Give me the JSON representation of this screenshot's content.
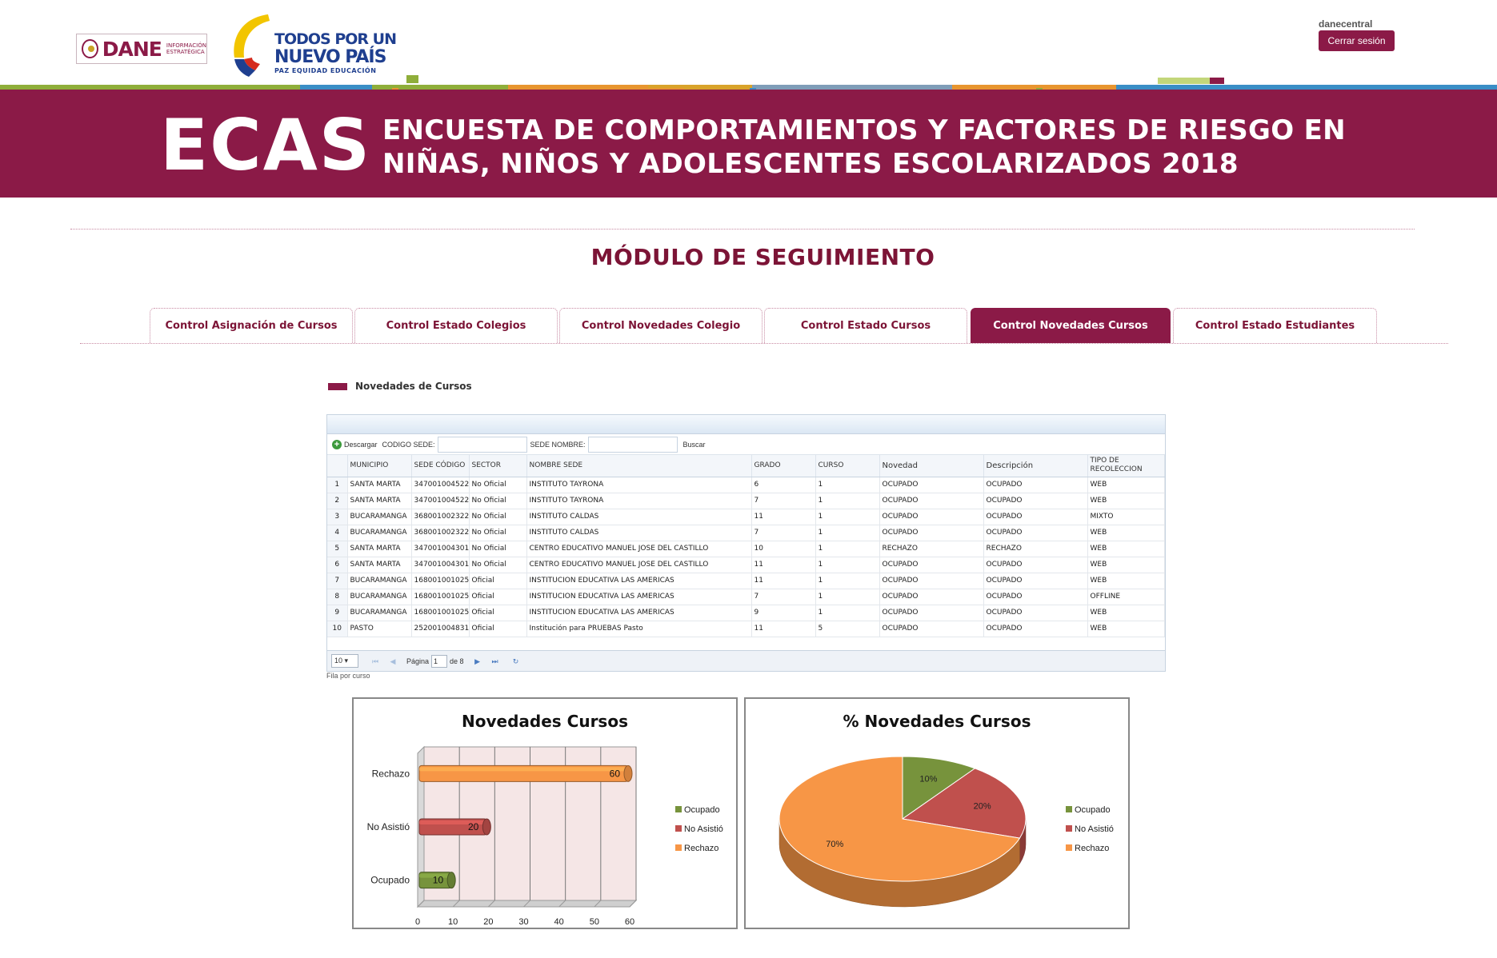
{
  "header": {
    "dane_logo_text": "DANE",
    "dane_logo_sub1": "INFORMACIÓN",
    "dane_logo_sub2": "ESTRATÉGICA",
    "gov_logo_line1": "TODOS POR UN",
    "gov_logo_line2": "NUEVO PAÍS",
    "gov_logo_line3": "PAZ  EQUIDAD  EDUCACIÓN",
    "username": "danecentral",
    "logout_label": "Cerrar sesión"
  },
  "banner": {
    "acronym": "ECAS",
    "title_line1": "ENCUESTA DE COMPORTAMIENTOS Y FACTORES DE RIESGO EN",
    "title_line2": "NIÑAS, NIÑOS Y ADOLESCENTES ESCOLARIZADOS 2018"
  },
  "page_title": "MÓDULO DE SEGUIMIENTO",
  "tabs": [
    {
      "label": "Control Asignación de Cursos",
      "active": false
    },
    {
      "label": "Control Estado Colegios",
      "active": false
    },
    {
      "label": "Control Novedades Colegio",
      "active": false
    },
    {
      "label": "Control Estado Cursos",
      "active": false
    },
    {
      "label": "Control Novedades Cursos",
      "active": true
    },
    {
      "label": "Control Estado Estudiantes",
      "active": false
    }
  ],
  "section_label": "Novedades de Cursos",
  "toolbar": {
    "download_label": "Descargar",
    "codigo_label": "CODIGO SEDE:",
    "codigo_value": "",
    "nombre_label": "SEDE NOMBRE:",
    "nombre_value": "",
    "search_label": "Buscar"
  },
  "table": {
    "columns": [
      "MUNICIPIO",
      "SEDE CÓDIGO",
      "SECTOR",
      "NOMBRE SEDE",
      "GRADO",
      "CURSO",
      "Novedad",
      "Descripción",
      "TIPO DE RECOLECCION"
    ],
    "rows": [
      [
        "1",
        "SANTA MARTA",
        "347001004522",
        "No Oficial",
        "INSTITUTO TAYRONA",
        "6",
        "1",
        "OCUPADO",
        "OCUPADO",
        "WEB"
      ],
      [
        "2",
        "SANTA MARTA",
        "347001004522",
        "No Oficial",
        "INSTITUTO TAYRONA",
        "7",
        "1",
        "OCUPADO",
        "OCUPADO",
        "WEB"
      ],
      [
        "3",
        "BUCARAMANGA",
        "368001002322",
        "No Oficial",
        "INSTITUTO CALDAS",
        "11",
        "1",
        "OCUPADO",
        "OCUPADO",
        "MIXTO"
      ],
      [
        "4",
        "BUCARAMANGA",
        "368001002322",
        "No Oficial",
        "INSTITUTO CALDAS",
        "7",
        "1",
        "OCUPADO",
        "OCUPADO",
        "WEB"
      ],
      [
        "5",
        "SANTA MARTA",
        "347001004301",
        "No Oficial",
        "CENTRO EDUCATIVO MANUEL JOSE DEL CASTILLO",
        "10",
        "1",
        "RECHAZO",
        "RECHAZO",
        "WEB"
      ],
      [
        "6",
        "SANTA MARTA",
        "347001004301",
        "No Oficial",
        "CENTRO EDUCATIVO MANUEL JOSE DEL CASTILLO",
        "11",
        "1",
        "OCUPADO",
        "OCUPADO",
        "WEB"
      ],
      [
        "7",
        "BUCARAMANGA",
        "168001001025",
        "Oficial",
        "INSTITUCION EDUCATIVA LAS AMERICAS",
        "11",
        "1",
        "OCUPADO",
        "OCUPADO",
        "WEB"
      ],
      [
        "8",
        "BUCARAMANGA",
        "168001001025",
        "Oficial",
        "INSTITUCION EDUCATIVA LAS AMERICAS",
        "7",
        "1",
        "OCUPADO",
        "OCUPADO",
        "OFFLINE"
      ],
      [
        "9",
        "BUCARAMANGA",
        "168001001025",
        "Oficial",
        "INSTITUCION EDUCATIVA LAS AMERICAS",
        "9",
        "1",
        "OCUPADO",
        "OCUPADO",
        "WEB"
      ],
      [
        "10",
        "PASTO",
        "252001004831",
        "Oficial",
        "Institución para PRUEBAS Pasto",
        "11",
        "5",
        "OCUPADO",
        "OCUPADO",
        "WEB"
      ]
    ]
  },
  "pager": {
    "rows_per_page": "10",
    "page_label": "Página",
    "current_page": "1",
    "of_label": "de 8",
    "caption": "Fila por curso"
  },
  "colors": {
    "brand": "#8b1a47",
    "ocupado": "#77933c",
    "no_asistio": "#c0504d",
    "rechazo": "#f79646"
  },
  "chart_data": [
    {
      "type": "bar",
      "orientation": "horizontal",
      "title": "Novedades Cursos",
      "categories": [
        "Ocupado",
        "No Asistió",
        "Rechazo"
      ],
      "values": [
        10,
        20,
        60
      ],
      "data_labels": [
        "10",
        "20",
        "60"
      ],
      "xlim": [
        0,
        60
      ],
      "x_ticks": [
        "0",
        "10",
        "20",
        "30",
        "40",
        "50",
        "60"
      ],
      "legend": [
        "Ocupado",
        "No Asistió",
        "Rechazo"
      ],
      "legend_position": "right",
      "grid": true
    },
    {
      "type": "pie",
      "title": "% Novedades Cursos",
      "categories": [
        "Ocupado",
        "No Asistió",
        "Rechazo"
      ],
      "values": [
        10,
        20,
        70
      ],
      "data_labels": [
        "10%",
        "20%",
        "70%"
      ],
      "legend": [
        "Ocupado",
        "No Asistió",
        "Rechazo"
      ],
      "legend_position": "right"
    }
  ]
}
